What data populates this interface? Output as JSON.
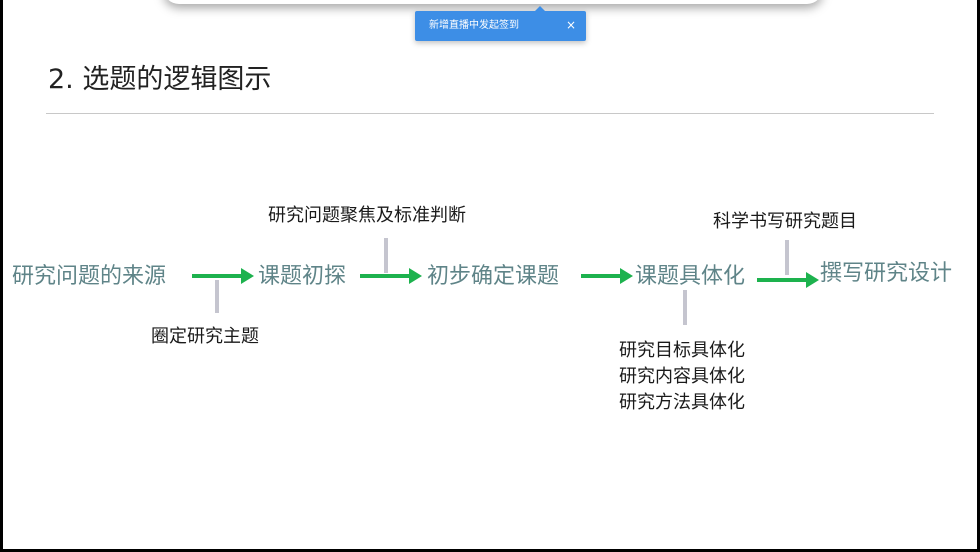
{
  "toast": {
    "message": "新增直播中发起签到",
    "close": "×"
  },
  "slide": {
    "title": "2. 选题的逻辑图示",
    "flow": {
      "nodes": [
        "研究问题的来源",
        "课题初探",
        "初步确定课题",
        "课题具体化",
        "撰写研究设计"
      ],
      "notes": {
        "scope": "圈定研究主题",
        "focus": "研究问题聚焦及标准判断",
        "concretize": [
          "研究目标具体化",
          "研究内容具体化",
          "研究方法具体化"
        ],
        "write_title": "科学书写研究题目"
      }
    }
  },
  "colors": {
    "node_text": "#5f8488",
    "arrow": "#1db24e",
    "toast_bg": "#3d8ee6",
    "tick": "#c5c5cf"
  }
}
